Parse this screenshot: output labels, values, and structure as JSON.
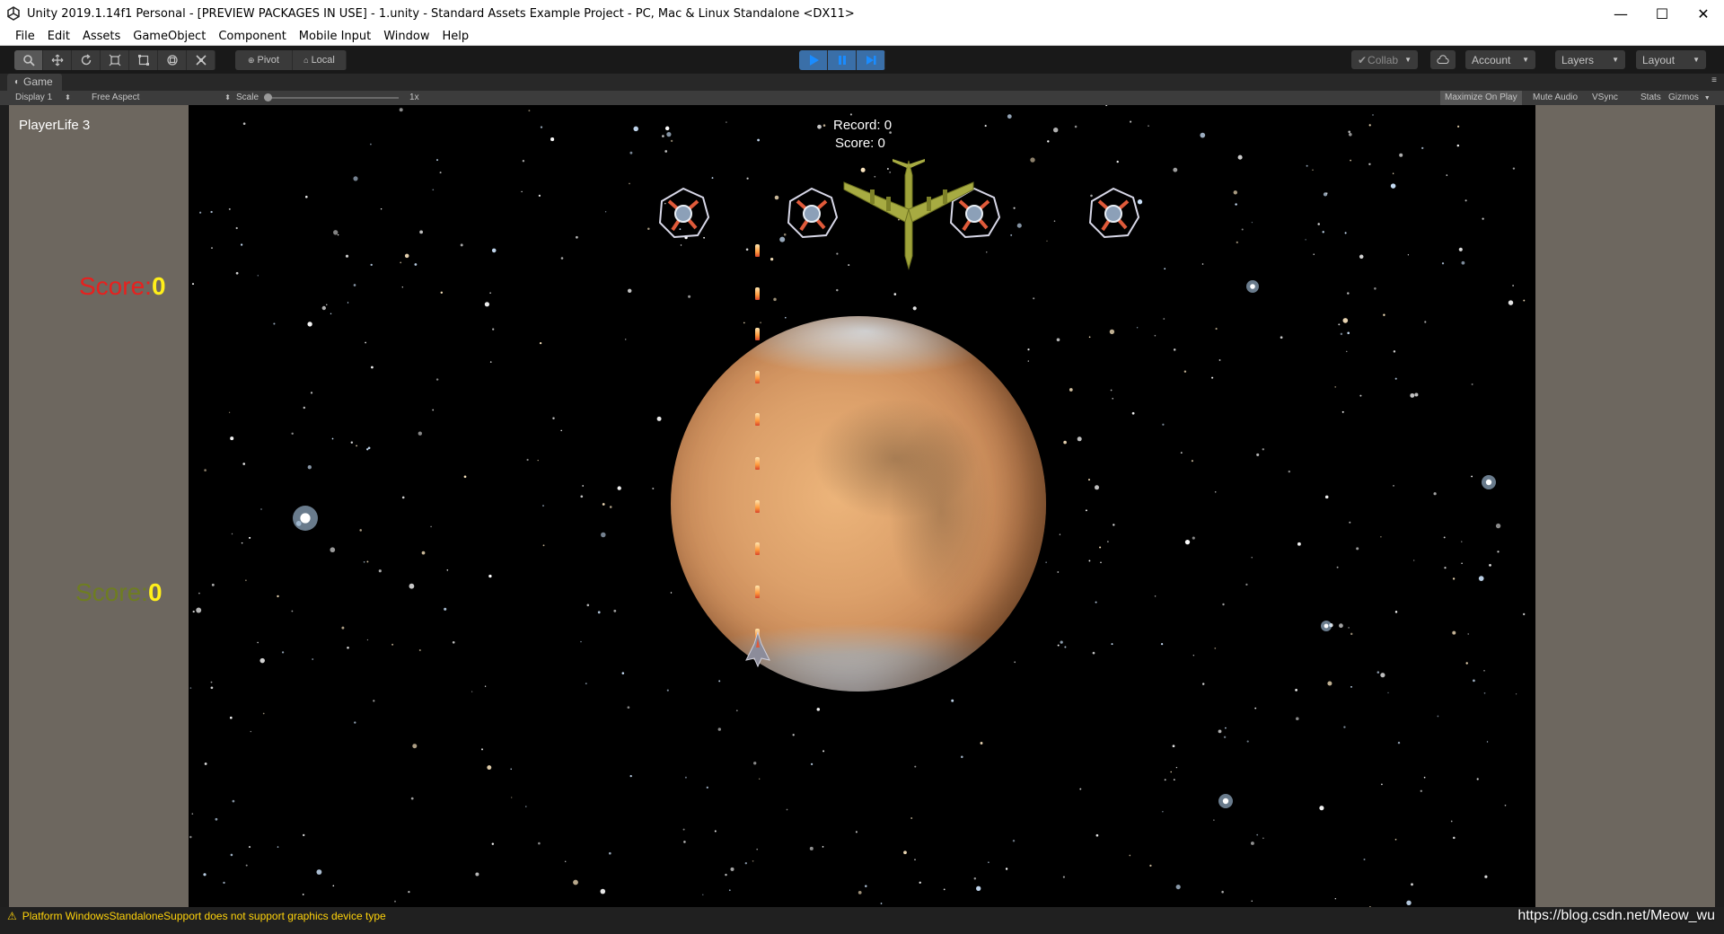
{
  "window": {
    "title": "Unity 2019.1.14f1 Personal - [PREVIEW PACKAGES IN USE] - 1.unity - Standard Assets Example Project - PC, Mac & Linux Standalone <DX11>",
    "minimize": "—",
    "maximize": "☐",
    "close": "✕"
  },
  "menu": [
    "File",
    "Edit",
    "Assets",
    "GameObject",
    "Component",
    "Mobile Input",
    "Window",
    "Help"
  ],
  "toolbar": {
    "tools": [
      "hand-tool",
      "move-tool",
      "rotate-tool",
      "scale-tool",
      "rect-tool",
      "transform-tool",
      "custom-tool"
    ],
    "pivot_label": "Pivot",
    "local_label": "Local",
    "play_state": "playing",
    "collab_label": "Collab",
    "account_label": "Account",
    "layers_label": "Layers",
    "layout_label": "Layout"
  },
  "game_tab": {
    "label": "Game",
    "display": "Display 1",
    "aspect": "Free Aspect",
    "scale_label": "Scale",
    "scale_value": "1x",
    "maximize_on_play": "Maximize On Play",
    "mute_audio": "Mute Audio",
    "vsync": "VSync",
    "stats": "Stats",
    "gizmos": "Gizmos"
  },
  "hud": {
    "player_life": "PlayerLife 3",
    "record": "Record: 0",
    "score": "Score: 0",
    "score_p1_label": "Score:",
    "score_p1_value": "0",
    "score_p2_label": "Score:",
    "score_p2_value": "0",
    "colors": {
      "score_p1_label": "#e8201e",
      "score_p2_label": "#6e7d22",
      "score_value": "#ffef1a"
    }
  },
  "status": {
    "message": "Platform WindowsStandaloneSupport does not support graphics device type",
    "watermark": "https://blog.csdn.net/Meow_wu"
  }
}
